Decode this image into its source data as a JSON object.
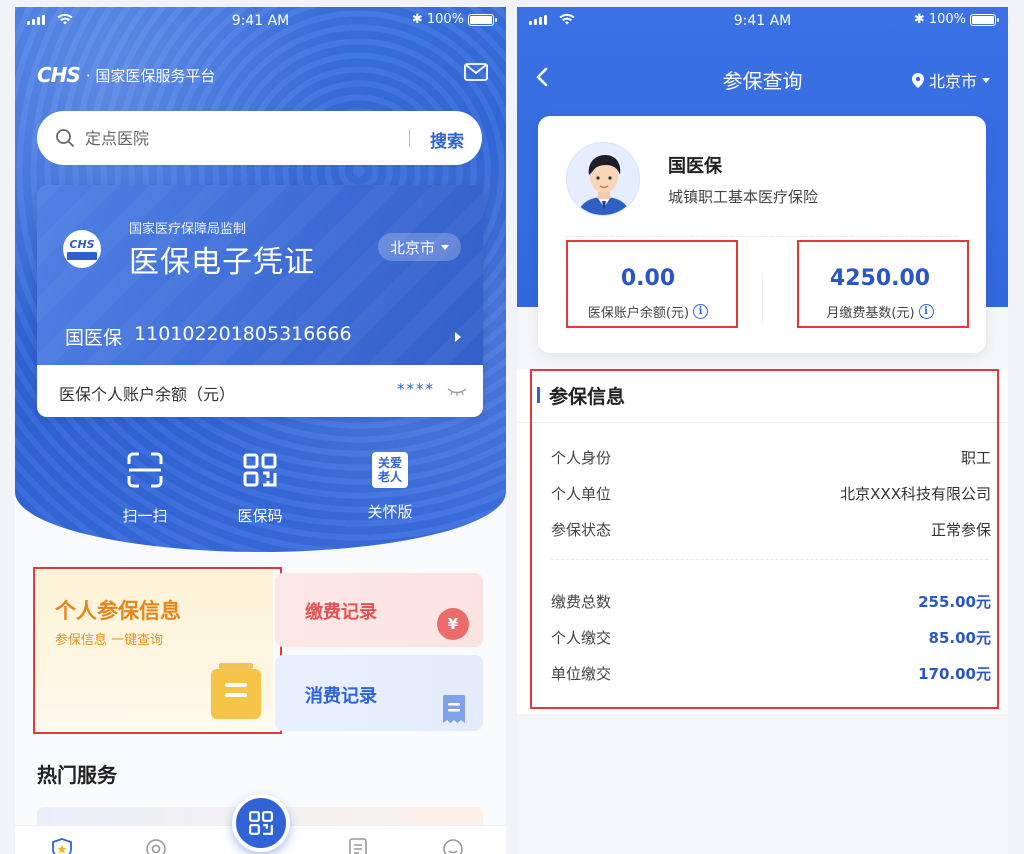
{
  "status_bar": {
    "time": "9:41 AM",
    "battery": "100%"
  },
  "left": {
    "brand_logo": "CHS",
    "brand_text": "· 国家医保服务平台",
    "search": {
      "placeholder": "定点医院",
      "button": "搜索"
    },
    "card": {
      "seal_logo": "CHS",
      "supervision": "国家医疗保障局监制",
      "title": "医保电子凭证",
      "city": "北京市",
      "holder_name": "国医保",
      "holder_id": "110102201805316666"
    },
    "balance": {
      "label": "医保个人账户余额（元）",
      "masked": "****"
    },
    "quick_actions": [
      {
        "label": "扫一扫",
        "icon": "scan-icon"
      },
      {
        "label": "医保码",
        "icon": "qr-code-icon"
      },
      {
        "label": "关怀版",
        "icon": "care-icon",
        "icon_text": "关爱老人"
      }
    ],
    "tiles": {
      "personal": {
        "title": "个人参保信息",
        "subtitle": "参保信息 一键查询"
      },
      "payment": {
        "title": "缴费记录"
      },
      "consume": {
        "title": "消费记录"
      }
    },
    "hot_services_title": "热门服务",
    "tabbar_icons": [
      "shield-home-icon",
      "discover-icon",
      "qr-code-icon",
      "list-icon",
      "profile-icon"
    ]
  },
  "right": {
    "title": "参保查询",
    "location": "北京市",
    "profile": {
      "name": "国医保",
      "insurance_type": "城镇职工基本医疗保险"
    },
    "stats": [
      {
        "value": "0.00",
        "label": "医保账户余额(元)"
      },
      {
        "value": "4250.00",
        "label": "月缴费基数(元)"
      }
    ],
    "section_title": "参保信息",
    "info_rows": [
      {
        "key": "个人身份",
        "value": "职工"
      },
      {
        "key": "个人单位",
        "value": "北京XXX科技有限公司"
      },
      {
        "key": "参保状态",
        "value": "正常参保"
      }
    ],
    "payment_rows": [
      {
        "key": "缴费总数",
        "value": "255.00元"
      },
      {
        "key": "个人缴交",
        "value": "85.00元"
      },
      {
        "key": "单位缴交",
        "value": "170.00元"
      }
    ]
  },
  "colors": {
    "primary": "#2f63d6",
    "highlight": "#e23a3a",
    "orange": "#e5861b",
    "red": "#e25252"
  }
}
